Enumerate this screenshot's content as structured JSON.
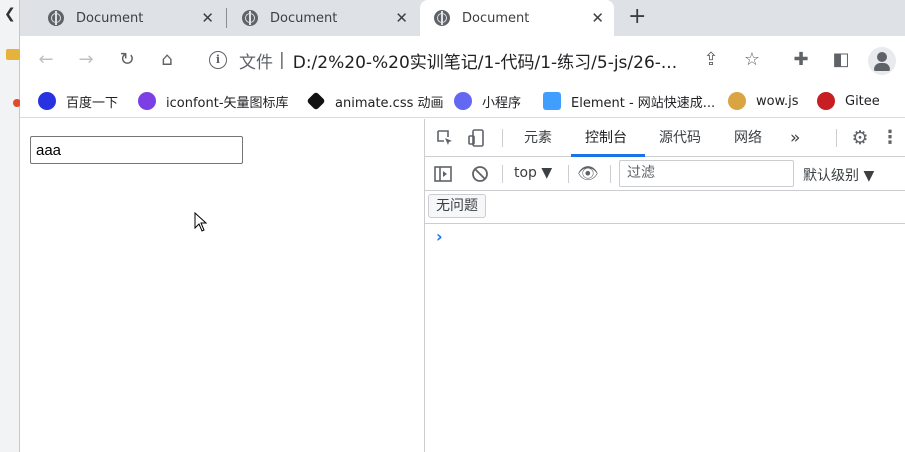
{
  "tabs": [
    {
      "title": "Document"
    },
    {
      "title": "Document"
    },
    {
      "title": "Document"
    }
  ],
  "toolbar": {
    "security_chip": "文件",
    "separator": "|",
    "url": "D:/2%20-%20实训笔记/1-代码/1-练习/5-js/26-..."
  },
  "bookmarks": [
    {
      "label": "百度一下",
      "icon": "baidu-icon",
      "color": "#2932e1"
    },
    {
      "label": "iconfont-矢量图标库",
      "icon": "iconfont-icon",
      "color": "#7b3fe4"
    },
    {
      "label": "animate.css 动画",
      "icon": "animate-icon",
      "color": "#111111"
    },
    {
      "label": "小程序",
      "icon": "miniprogram-icon",
      "color": "#6467f2"
    },
    {
      "label": "Element - 网站快速成...",
      "icon": "element-icon",
      "color": "#409eff"
    },
    {
      "label": "wow.js",
      "icon": "doge-icon",
      "color": "#d9a441"
    },
    {
      "label": "Gitee",
      "icon": "gitee-icon",
      "color": "#c71d23"
    }
  ],
  "page": {
    "input_value": "aaa"
  },
  "devtools": {
    "tabs": [
      {
        "label": "元素"
      },
      {
        "label": "控制台"
      },
      {
        "label": "源代码"
      },
      {
        "label": "网络"
      }
    ],
    "more": "»",
    "context": "top ▼",
    "filter_placeholder": "过滤",
    "levels": "默认级别 ▼",
    "issues": "无问题",
    "prompt": "›"
  },
  "colors": {
    "accent": "#1a73e8",
    "tabstrip_bg": "#dee1e6"
  }
}
